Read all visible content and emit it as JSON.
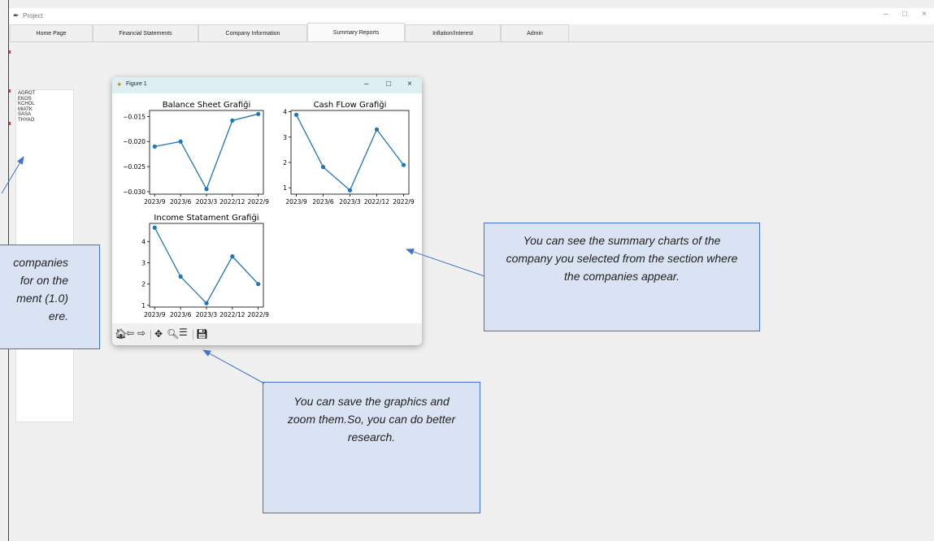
{
  "window": {
    "title": "Project",
    "controls": [
      "–",
      "□",
      "×"
    ]
  },
  "tabs": [
    {
      "label": "Home Page",
      "selected": false
    },
    {
      "label": "Financial Statements",
      "selected": false
    },
    {
      "label": "Company Information",
      "selected": false
    },
    {
      "label": "Summary Reports",
      "selected": true
    },
    {
      "label": "Inflation/Interest",
      "selected": false
    },
    {
      "label": "Admin",
      "selected": false
    }
  ],
  "companies": [
    "AGROT",
    "EKOS",
    "KCHOL",
    "MIATK",
    "SASA",
    "THYAO"
  ],
  "figure": {
    "title": "Figure 1",
    "controls": [
      "–",
      "□",
      "×"
    ],
    "toolbar": [
      "home-icon",
      "back-icon",
      "forward-icon",
      "pan-icon",
      "zoom-icon",
      "configure-icon",
      "save-icon"
    ]
  },
  "chart_data": [
    {
      "type": "line",
      "title": "Balance Sheet Grafiği",
      "categories": [
        "2023/9",
        "2023/6",
        "2023/3",
        "2022/12",
        "2022/9"
      ],
      "values": [
        -0.021,
        -0.02,
        -0.0295,
        -0.0158,
        -0.0145
      ],
      "ylim": [
        -0.0305,
        -0.0138
      ],
      "yticks": [
        -0.015,
        -0.02,
        -0.025,
        -0.03
      ],
      "ytick_labels": [
        "−0.015",
        "−0.020",
        "−0.025",
        "−0.030"
      ],
      "color": "#1f77b4",
      "marker": "circle"
    },
    {
      "type": "line",
      "title": "Cash FLow Grafiği",
      "categories": [
        "2023/9",
        "2023/6",
        "2023/3",
        "2022/12",
        "2022/9"
      ],
      "values": [
        3.88,
        1.82,
        0.9,
        3.3,
        1.9
      ],
      "ylim": [
        0.75,
        4.05
      ],
      "yticks": [
        1,
        2,
        3,
        4
      ],
      "ytick_labels": [
        "1",
        "2",
        "3",
        "4"
      ],
      "color": "#1f77b4",
      "marker": "circle"
    },
    {
      "type": "line",
      "title": "Income Statament Grafiği",
      "categories": [
        "2023/9",
        "2023/6",
        "2023/3",
        "2022/12",
        "2022/9"
      ],
      "values": [
        4.65,
        2.35,
        1.1,
        3.3,
        2.0
      ],
      "ylim": [
        0.92,
        4.85
      ],
      "yticks": [
        1,
        2,
        3,
        4
      ],
      "ytick_labels": [
        "1",
        "2",
        "3",
        "4"
      ],
      "color": "#1f77b4",
      "marker": "circle"
    }
  ],
  "callouts": {
    "left_lines": [
      "companies",
      "for on the",
      "ment (1.0)",
      "ere."
    ],
    "right": "You can see the summary charts of the company you selected from the section where the companies appear.",
    "bottom": "You can save the graphics and zoom them.So, you can do better research."
  }
}
